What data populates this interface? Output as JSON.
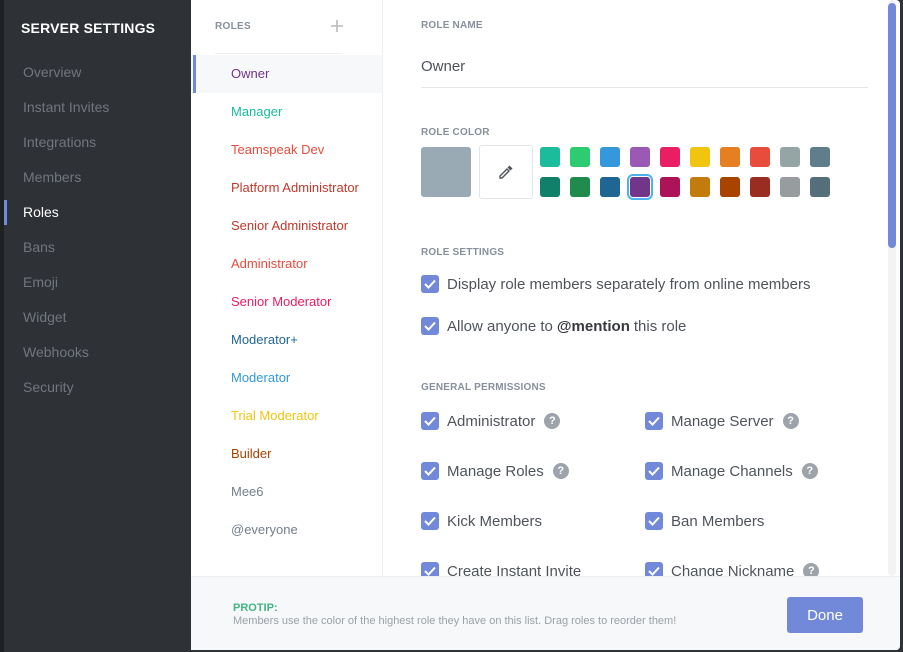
{
  "sidebar": {
    "title": "SERVER SETTINGS",
    "items": [
      {
        "label": "Overview"
      },
      {
        "label": "Instant Invites"
      },
      {
        "label": "Integrations"
      },
      {
        "label": "Members"
      },
      {
        "label": "Roles",
        "active": true
      },
      {
        "label": "Bans"
      },
      {
        "label": "Emoji"
      },
      {
        "label": "Widget"
      },
      {
        "label": "Webhooks"
      },
      {
        "label": "Security"
      }
    ]
  },
  "roles": {
    "header": "ROLES",
    "add_icon": "plus-icon",
    "items": [
      {
        "label": "Owner",
        "color": "#71368a",
        "active": true
      },
      {
        "label": "Manager",
        "color": "#1abc9c"
      },
      {
        "label": "Teamspeak Dev",
        "color": "#e74c3c"
      },
      {
        "label": "Platform Administrator",
        "color": "#c0392b"
      },
      {
        "label": "Senior Administrator",
        "color": "#c0392b"
      },
      {
        "label": "Administrator",
        "color": "#e74c3c"
      },
      {
        "label": "Senior Moderator",
        "color": "#e91e63"
      },
      {
        "label": "Moderator+",
        "color": "#206694"
      },
      {
        "label": "Moderator",
        "color": "#3498db"
      },
      {
        "label": "Trial Moderator",
        "color": "#f1c40f"
      },
      {
        "label": "Builder",
        "color": "#a84300"
      },
      {
        "label": "Mee6",
        "color": "#747f8d"
      },
      {
        "label": "@everyone",
        "color": "#747f8d"
      }
    ]
  },
  "role_name": {
    "label": "ROLE NAME",
    "value": "Owner"
  },
  "role_color": {
    "label": "ROLE COLOR",
    "preview": "#99aab5",
    "picker_icon": "eyedropper-icon",
    "swatches_top": [
      "#1abc9c",
      "#2ecc71",
      "#3498db",
      "#9b59b6",
      "#e91e63",
      "#f1c40f",
      "#e67e22",
      "#e74c3c",
      "#95a5a6",
      "#607d8b"
    ],
    "swatches_bottom": [
      "#11806a",
      "#1f8b4c",
      "#206694",
      "#71368a",
      "#ad1457",
      "#c27c0e",
      "#a84300",
      "#992d22",
      "#979c9f",
      "#546e7a"
    ],
    "selected": "#71368a"
  },
  "role_settings": {
    "label": "ROLE SETTINGS",
    "display_separately": "Display role members separately from online members",
    "mention_prefix": "Allow anyone to",
    "mention_word": "@mention",
    "mention_suffix": "this role"
  },
  "permissions": {
    "label": "GENERAL PERMISSIONS",
    "administrator": "Administrator",
    "manage_server": "Manage Server",
    "manage_roles": "Manage Roles",
    "manage_channels": "Manage Channels",
    "kick_members": "Kick Members",
    "ban_members": "Ban Members",
    "create_invite": "Create Instant Invite",
    "change_nickname": "Change Nickname",
    "help_glyph": "?"
  },
  "footer": {
    "protip_label": "PROTIP:",
    "protip_text": "Members use the color of the highest role they have on this list. Drag roles to reorder them!",
    "done_label": "Done"
  }
}
